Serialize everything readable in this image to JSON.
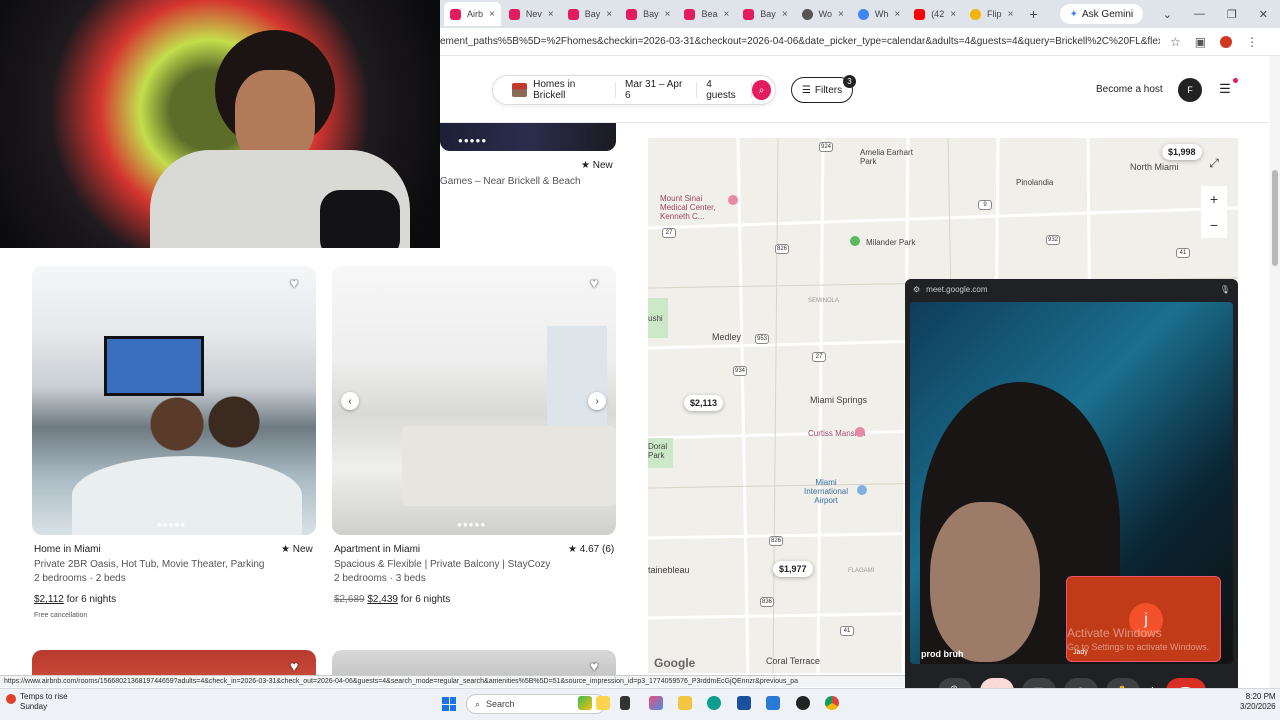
{
  "browser": {
    "tabs": [
      {
        "label": "Airb",
        "color": "#e31c5f",
        "active": true
      },
      {
        "label": "Nev",
        "color": "#e31c5f"
      },
      {
        "label": "Bay",
        "color": "#e31c5f"
      },
      {
        "label": "Bay",
        "color": "#e31c5f"
      },
      {
        "label": "Bea",
        "color": "#e31c5f"
      },
      {
        "label": "Bay",
        "color": "#e31c5f"
      },
      {
        "label": "Wo",
        "color": "#555555"
      },
      {
        "label": "Wh",
        "color": "#4285f4"
      },
      {
        "label": "(42",
        "color": "#ff0000"
      },
      {
        "label": "Flip",
        "color": "#f4b400"
      }
    ],
    "close_glyph": "×",
    "new_tab_glyph": "+",
    "ask_gemini": "Ask Gemini",
    "window_controls": [
      "⌄",
      "—",
      "❐",
      "✕"
    ],
    "url": "ement_paths%5B%5D=%2Fhomes&checkin=2026-03-31&checkout=2026-04-06&date_picker_type=calendar&adults=4&guests=4&query=Brickell%2C%20FL&flexible_tri...",
    "status_url": "https://www.airbnb.com/rooms/1566802136819744659?adults=4&check_in=2026-03-31&check_out=2026-04-06&guests=4&search_mode=regular_search&amenities%5B%5D=51&source_impression_id=p3_1774059576_P3rddmEcGjQEnnzr&previous_pa"
  },
  "header": {
    "location": "Homes in Brickell",
    "dates": "Mar 31 – Apr 6",
    "guests": "4 guests",
    "filters_label": "Filters",
    "filters_count": "3",
    "become_host": "Become a host",
    "avatar_letter": "F",
    "brand_color": "#e31c5f"
  },
  "top_listing": {
    "rating": "New",
    "desc": "Games – Near Brickell & Beach"
  },
  "listings": [
    {
      "type": "Home in Miami",
      "rating": "New",
      "desc": "Private 2BR Oasis, Hot Tub, Movie Theater, Parking",
      "beds": "2 bedrooms · 2 beds",
      "price": "$2,112",
      "price_suffix": "for 6 nights",
      "note": "Free cancellation"
    },
    {
      "type": "Apartment in Miami",
      "rating": "4.67 (6)",
      "desc": "Spacious & Flexible | Private Balcony | StayCozy",
      "beds": "2 bedrooms · 3 beds",
      "original_price": "$2,689",
      "price": "$2,439",
      "price_suffix": "for 6 nights"
    }
  ],
  "map": {
    "labels": {
      "mount_sinai": "Mount Sinai Medical Center, Kenneth C...",
      "amelia": "Amelia Earhart Park",
      "pinolandia": "Pinolandia",
      "north_miami": "North Miami",
      "milander": "Milander Park",
      "medley": "Medley",
      "miami_springs": "Miami Springs",
      "curtiss": "Curtiss Mansion",
      "doral": "Doral Park",
      "airport": "Miami International Airport",
      "fontainebleau": "tainebleau",
      "coral_terrace": "Coral Terrace",
      "hialeah_gardens": "ushi",
      "flagami": "FLAGAMI",
      "seminola": "SEMINOLA",
      "google": "Google"
    },
    "shields": [
      "924",
      "27",
      "9",
      "932",
      "826",
      "953",
      "27",
      "934",
      "826",
      "836",
      "41",
      "836",
      "41",
      "1",
      "7",
      "27"
    ],
    "prices": [
      "$1,998",
      "$2,113",
      "$1,977"
    ]
  },
  "meet": {
    "domain": "meet.google.com",
    "participant_name": "prod bruh",
    "self_letter": "j",
    "self_name": "Jady",
    "watermark_title": "Activate Windows",
    "watermark_sub": "Go to Settings to activate Windows."
  },
  "taskbar": {
    "weather_title": "Temps to rise",
    "weather_sub": "Sunday",
    "search_placeholder": "Search",
    "time": "8:20 PM",
    "date": "3/20/2026"
  }
}
